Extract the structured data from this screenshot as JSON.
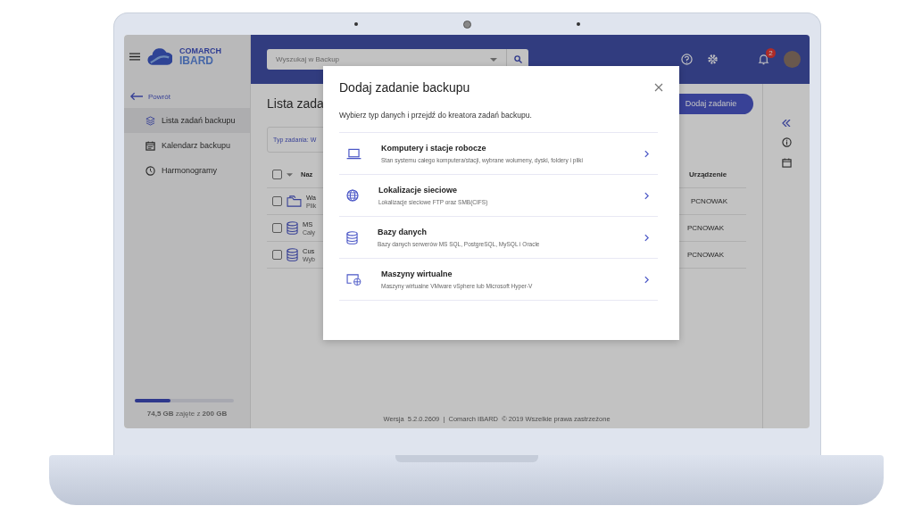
{
  "app": {
    "logo": {
      "line1": "COMARCH",
      "line2": "IBARD"
    },
    "search": {
      "placeholder": "Wyszukaj w Backup"
    },
    "notifications": {
      "count": "2"
    }
  },
  "sidebar": {
    "back": "Powrót",
    "items": [
      {
        "kind": "layers",
        "label": "Lista zadań backupu",
        "selected": true
      },
      {
        "kind": "calendar",
        "label": "Kalendarz backupu",
        "selected": false
      },
      {
        "kind": "clock",
        "label": "Harmonogramy",
        "selected": false
      }
    ],
    "storage": {
      "level": 0.36,
      "text": "**74,5 GB** zajęte z **200 GB**"
    }
  },
  "page": {
    "title": "Lista zada",
    "add_button": "Dodaj zadanie",
    "filter": "Typ zadania: W",
    "table": {
      "select_all_checked": false,
      "columns": [
        "Naz",
        "Urządzenie"
      ],
      "rows": [
        {
          "kind": "folder",
          "checked": false,
          "name": "Wa",
          "subtitle": "Plik",
          "device": "PCNOWAK"
        },
        {
          "kind": "database",
          "checked": false,
          "name": "MS",
          "subtitle": "Cały",
          "device": "PCNOWAK"
        },
        {
          "kind": "database",
          "checked": false,
          "name": "Cus",
          "subtitle": "Wyb",
          "device": "PCNOWAK"
        }
      ]
    }
  },
  "footer": "Wersja  5.2.0.2609  |  Comarch IBARD  © 2019 Wszelkie prawa zastrzeżone",
  "dialog": {
    "title": "Dodaj zadanie backupu",
    "intro": "Wybierz typ danych i przejdź do kreatora zadań backupu.",
    "options": [
      {
        "kind": "computer",
        "title": "Komputery i stacje robocze",
        "description": "Stan systemu całego komputera/stacji, wybrane wolumeny, dyski, foldery i pliki"
      },
      {
        "kind": "network",
        "title": "Lokalizacje sieciowe",
        "description": "Lokalizacje sieciowe FTP oraz SMB(CIFS)"
      },
      {
        "kind": "database",
        "title": "Bazy danych",
        "description": "Bazy danych serwerów MS SQL, PostgreSQL, MySQL i Oracle"
      },
      {
        "kind": "vm",
        "title": "Maszyny wirtualne",
        "description": "Maszyny wirtualne VMware vSphere lub Microsoft Hyper-V"
      }
    ]
  }
}
